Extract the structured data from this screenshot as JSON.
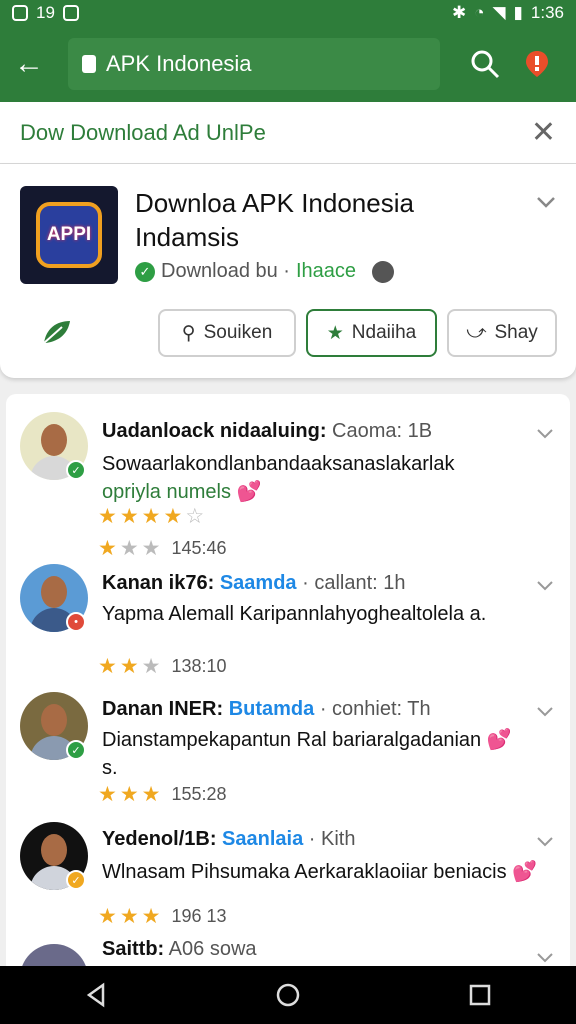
{
  "status_bar": {
    "time_left": "19",
    "time_right": "1:36"
  },
  "toolbar": {
    "url": "APK Indonesia"
  },
  "banner": {
    "text": "Dow Download Ad UnlPe",
    "close": "✕"
  },
  "app": {
    "icon_text": "APPI",
    "title": "Downloa APK Indonesia Indamsis",
    "by_label": "Download bu ·",
    "publisher": "Ihaace",
    "buttons": [
      {
        "label": "Souiken"
      },
      {
        "label": "Ndaiiha"
      },
      {
        "label": "Shay"
      }
    ]
  },
  "reviews": [
    {
      "name": "Uadanloack nidaaluing:",
      "tag": "",
      "meta": "Caoma: 1B",
      "text": "Sowaarlakondlanbandaaksanaslakarlak",
      "extra": "opriyla numels 💕",
      "stars_line1": [
        1,
        1,
        1,
        1,
        0
      ],
      "stars": [
        1,
        0,
        0
      ],
      "count": "145:46",
      "badge_color": "#2e9e44"
    },
    {
      "name": "Kanan ik76:",
      "tag": "Saamda",
      "meta": "· callant: 1h",
      "text": "Yapma Alemall Karipannlahyoghealtolela a.",
      "extra": "",
      "stars": [
        1,
        1,
        0
      ],
      "count": "138:10",
      "badge_color": "#e04a3a"
    },
    {
      "name": "Danan INER:",
      "tag": "Butamda",
      "meta": "· conhiet: Th",
      "text": "Dianstampekapantun Ral bariaralgadanian 💕 s.",
      "extra": "",
      "stars": [
        1,
        1,
        1
      ],
      "count": "155:28",
      "badge_color": "#2e9e44"
    },
    {
      "name": "Yedenol/1B:",
      "tag": "Saanlaia",
      "meta": "· Kith",
      "text": "Wlnasam Pihsumaka Aerkaraklaoiiar beniacis 💕",
      "extra": "",
      "stars": [
        1,
        1,
        1
      ],
      "count": "196 13",
      "badge_color": "#f0a820"
    },
    {
      "name": "Saittb:",
      "tag": "",
      "meta": "A06 sowa",
      "text": "",
      "extra": "",
      "stars": [],
      "count": "",
      "badge_color": "#2e9e44"
    }
  ]
}
